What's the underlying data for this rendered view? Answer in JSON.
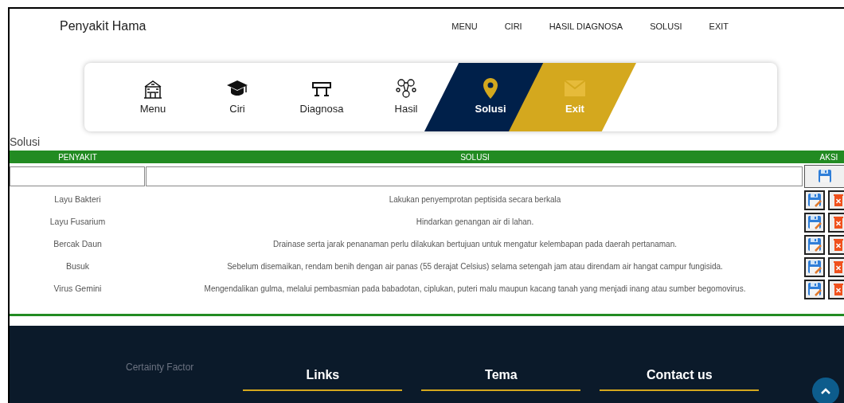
{
  "brand": "Penyakit Hama",
  "nav": [
    "MENU",
    "CIRI",
    "HASIL DIAGNOSA",
    "SOLUSI",
    "EXIT"
  ],
  "tabs": [
    {
      "label": "Menu",
      "kind": "plain",
      "selected": false
    },
    {
      "label": "Ciri",
      "kind": "plain",
      "selected": false
    },
    {
      "label": "Diagnosa",
      "kind": "plain",
      "selected": false
    },
    {
      "label": "Hasil",
      "kind": "plain",
      "selected": false
    },
    {
      "label": "Solusi",
      "kind": "plain",
      "selected": true
    },
    {
      "label": "Exit",
      "kind": "accent",
      "selected": false
    }
  ],
  "section_title": "Solusi",
  "table": {
    "columns": [
      "PENYAKIT",
      "SOLUSI",
      "AKSI"
    ],
    "rows": [
      {
        "penyakit": "Layu Bakteri",
        "solusi": "Lakukan penyemprotan peptisida secara berkala"
      },
      {
        "penyakit": "Layu Fusarium",
        "solusi": "Hindarkan genangan air di lahan."
      },
      {
        "penyakit": "Bercak Daun",
        "solusi": "Drainase serta jarak penanaman perlu dilakukan bertujuan untuk mengatur kelembapan pada daerah pertanaman."
      },
      {
        "penyakit": "Busuk",
        "solusi": "Sebelum disemaikan, rendam benih dengan air panas (55 derajat Celsius) selama setengah jam atau direndam air hangat campur fungisida."
      },
      {
        "penyakit": "Virus Gemini",
        "solusi": "Mengendalikan gulma, melalui pembasmian pada babadotan, ciplukan, puteri malu maupun kacang tanah yang menjadi inang atau sumber begomovirus."
      }
    ]
  },
  "footer": {
    "about_title": "Certainty Factor",
    "headings": [
      "Links",
      "Tema",
      "Contact us"
    ]
  }
}
